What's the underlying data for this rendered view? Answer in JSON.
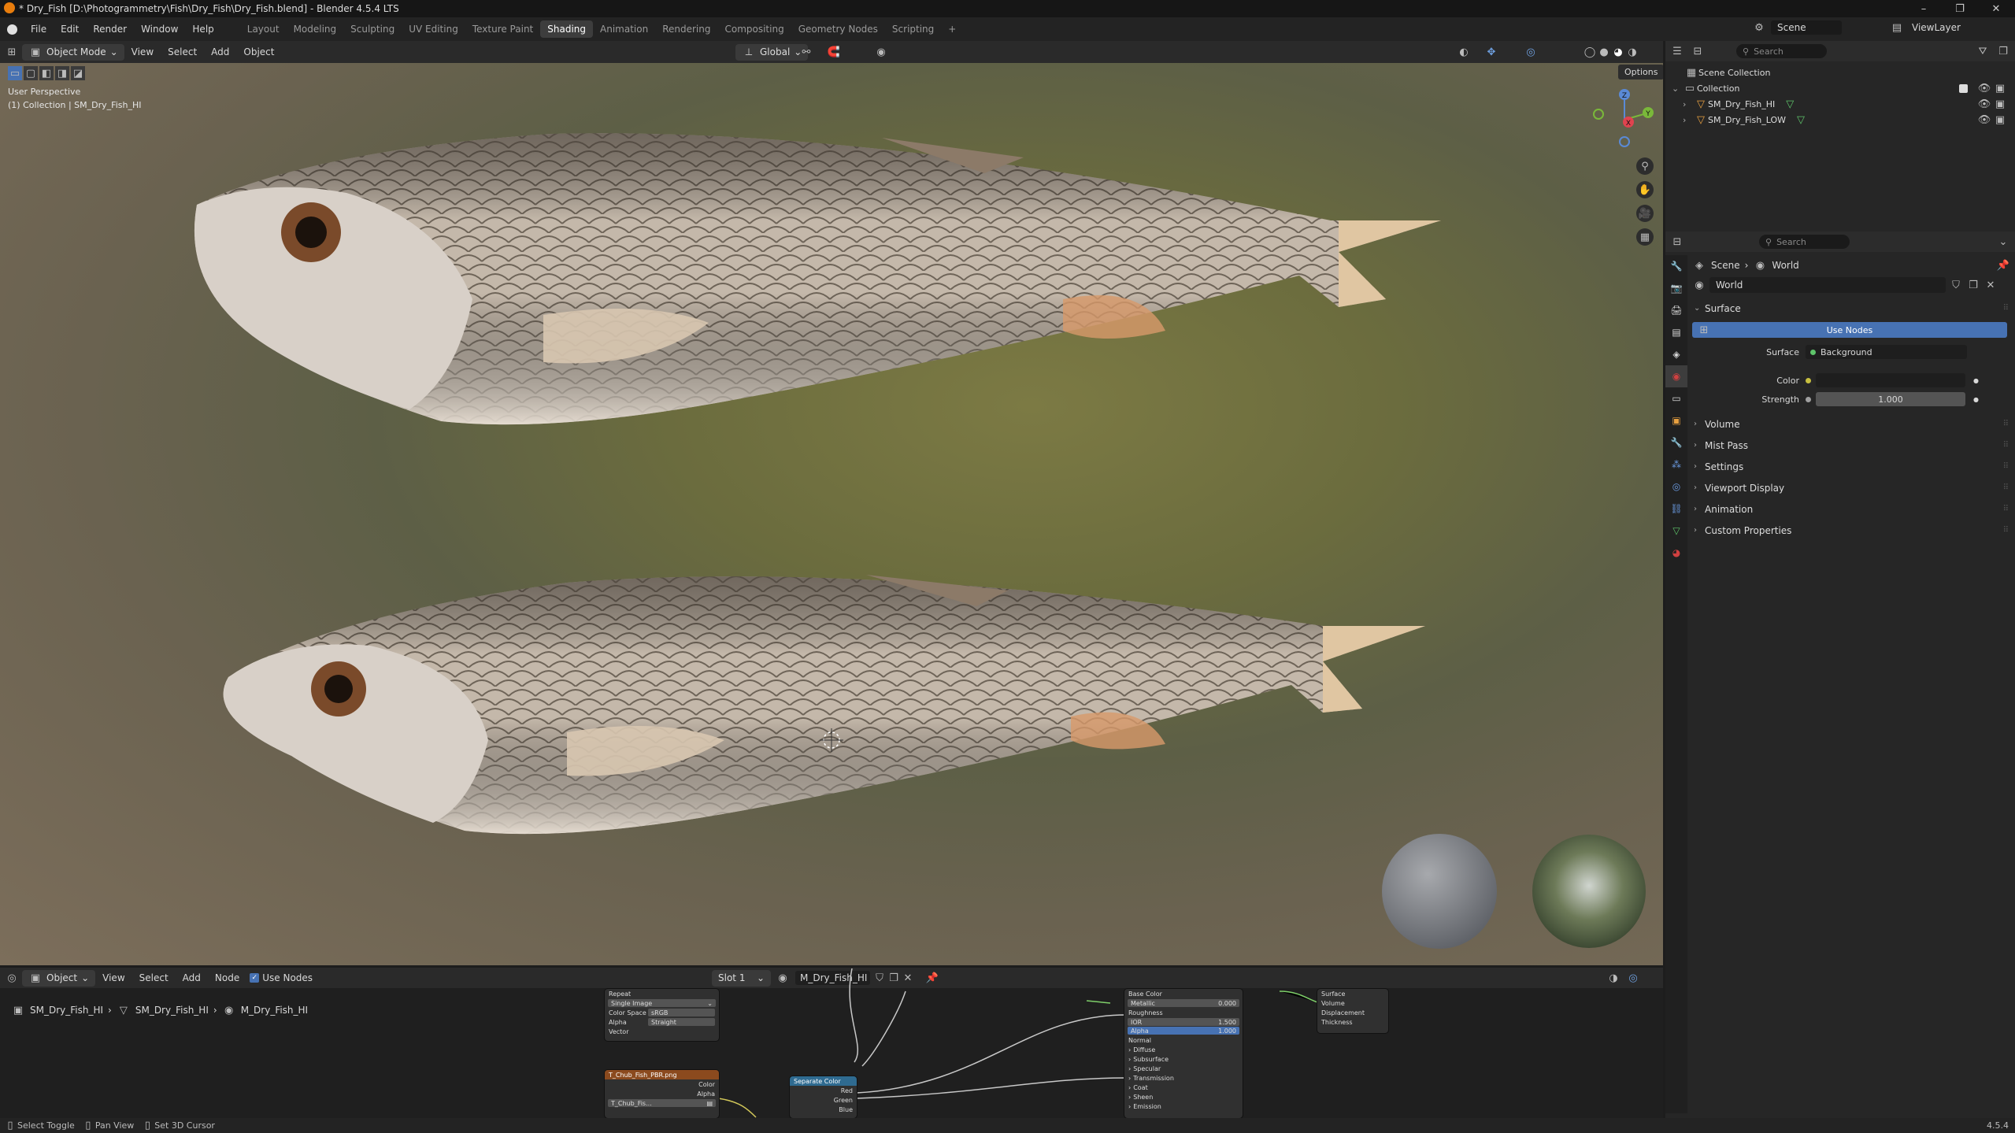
{
  "window": {
    "title": "* Dry_Fish [D:\\Photogrammetry\\Fish\\Dry_Fish\\Dry_Fish.blend] - Blender 4.5.4 LTS"
  },
  "menu": {
    "items": [
      "File",
      "Edit",
      "Render",
      "Window",
      "Help"
    ]
  },
  "workspaces": [
    "Layout",
    "Modeling",
    "Sculpting",
    "UV Editing",
    "Texture Paint",
    "Shading",
    "Animation",
    "Rendering",
    "Compositing",
    "Geometry Nodes",
    "Scripting"
  ],
  "active_workspace": "Shading",
  "topright": {
    "scene": "Scene",
    "view_layer": "ViewLayer"
  },
  "viewport": {
    "mode": "Object Mode",
    "menus": [
      "View",
      "Select",
      "Add",
      "Object"
    ],
    "transform_orientation": "Global",
    "options": "Options",
    "view_name": "User Perspective",
    "collection_info": "(1) Collection | SM_Dry_Fish_HI",
    "gizmo": {
      "z": "Z",
      "x": "X",
      "y": "Y"
    }
  },
  "node_editor": {
    "mode": "Object",
    "menus": [
      "View",
      "Select",
      "Add",
      "Node"
    ],
    "use_nodes_label": "Use Nodes",
    "slot": "Slot 1",
    "material": "M_Dry_Fish_HI",
    "breadcrumb": [
      "SM_Dry_Fish_HI",
      "SM_Dry_Fish_HI",
      "M_Dry_Fish_HI"
    ],
    "image_node": {
      "rows": [
        "Repeat",
        "Single Image"
      ],
      "color_space_label": "Color Space",
      "color_space": "sRGB",
      "alpha_label": "Alpha",
      "alpha": "Straight",
      "vector": "Vector"
    },
    "texture_node": {
      "title": "T_Chub_Fish_PBR.png",
      "color": "Color",
      "alpha": "Alpha",
      "image": "T_Chub_Fis..."
    },
    "separate_node": {
      "title": "Separate Color",
      "outputs": [
        "Red",
        "Green",
        "Blue"
      ]
    },
    "bsdf_node": {
      "inputs": [
        "Base Color",
        "Metallic",
        "Roughness",
        "IOR",
        "Alpha",
        "Normal"
      ],
      "metallic": "0.000",
      "ior": "1.500",
      "alpha": "1.000",
      "sections": [
        "Diffuse",
        "Subsurface",
        "Specular",
        "Transmission",
        "Coat",
        "Sheen",
        "Emission"
      ]
    },
    "output_node": {
      "inputs": [
        "Surface",
        "Volume",
        "Displacement",
        "Thickness"
      ]
    }
  },
  "outliner": {
    "search_placeholder": "Search",
    "scene_collection": "Scene Collection",
    "collection": "Collection",
    "objects": [
      "SM_Dry_Fish_HI",
      "SM_Dry_Fish_LOW"
    ]
  },
  "properties": {
    "search_placeholder": "Search",
    "breadcrumb": [
      "Scene",
      "World"
    ],
    "world_name": "World",
    "surface_panel": "Surface",
    "use_nodes_button": "Use Nodes",
    "surface_label": "Surface",
    "surface_value": "Background",
    "color_label": "Color",
    "strength_label": "Strength",
    "strength_value": "1.000",
    "panels": [
      "Volume",
      "Mist Pass",
      "Settings",
      "Viewport Display",
      "Animation",
      "Custom Properties"
    ]
  },
  "statusbar": {
    "items": [
      "Select Toggle",
      "Pan View",
      "Set 3D Cursor"
    ],
    "version": "4.5.4"
  },
  "colors": {
    "accent_blue": "#4772b3",
    "header": "#2a2a2a",
    "selected_tab": "#3d3d3d"
  }
}
